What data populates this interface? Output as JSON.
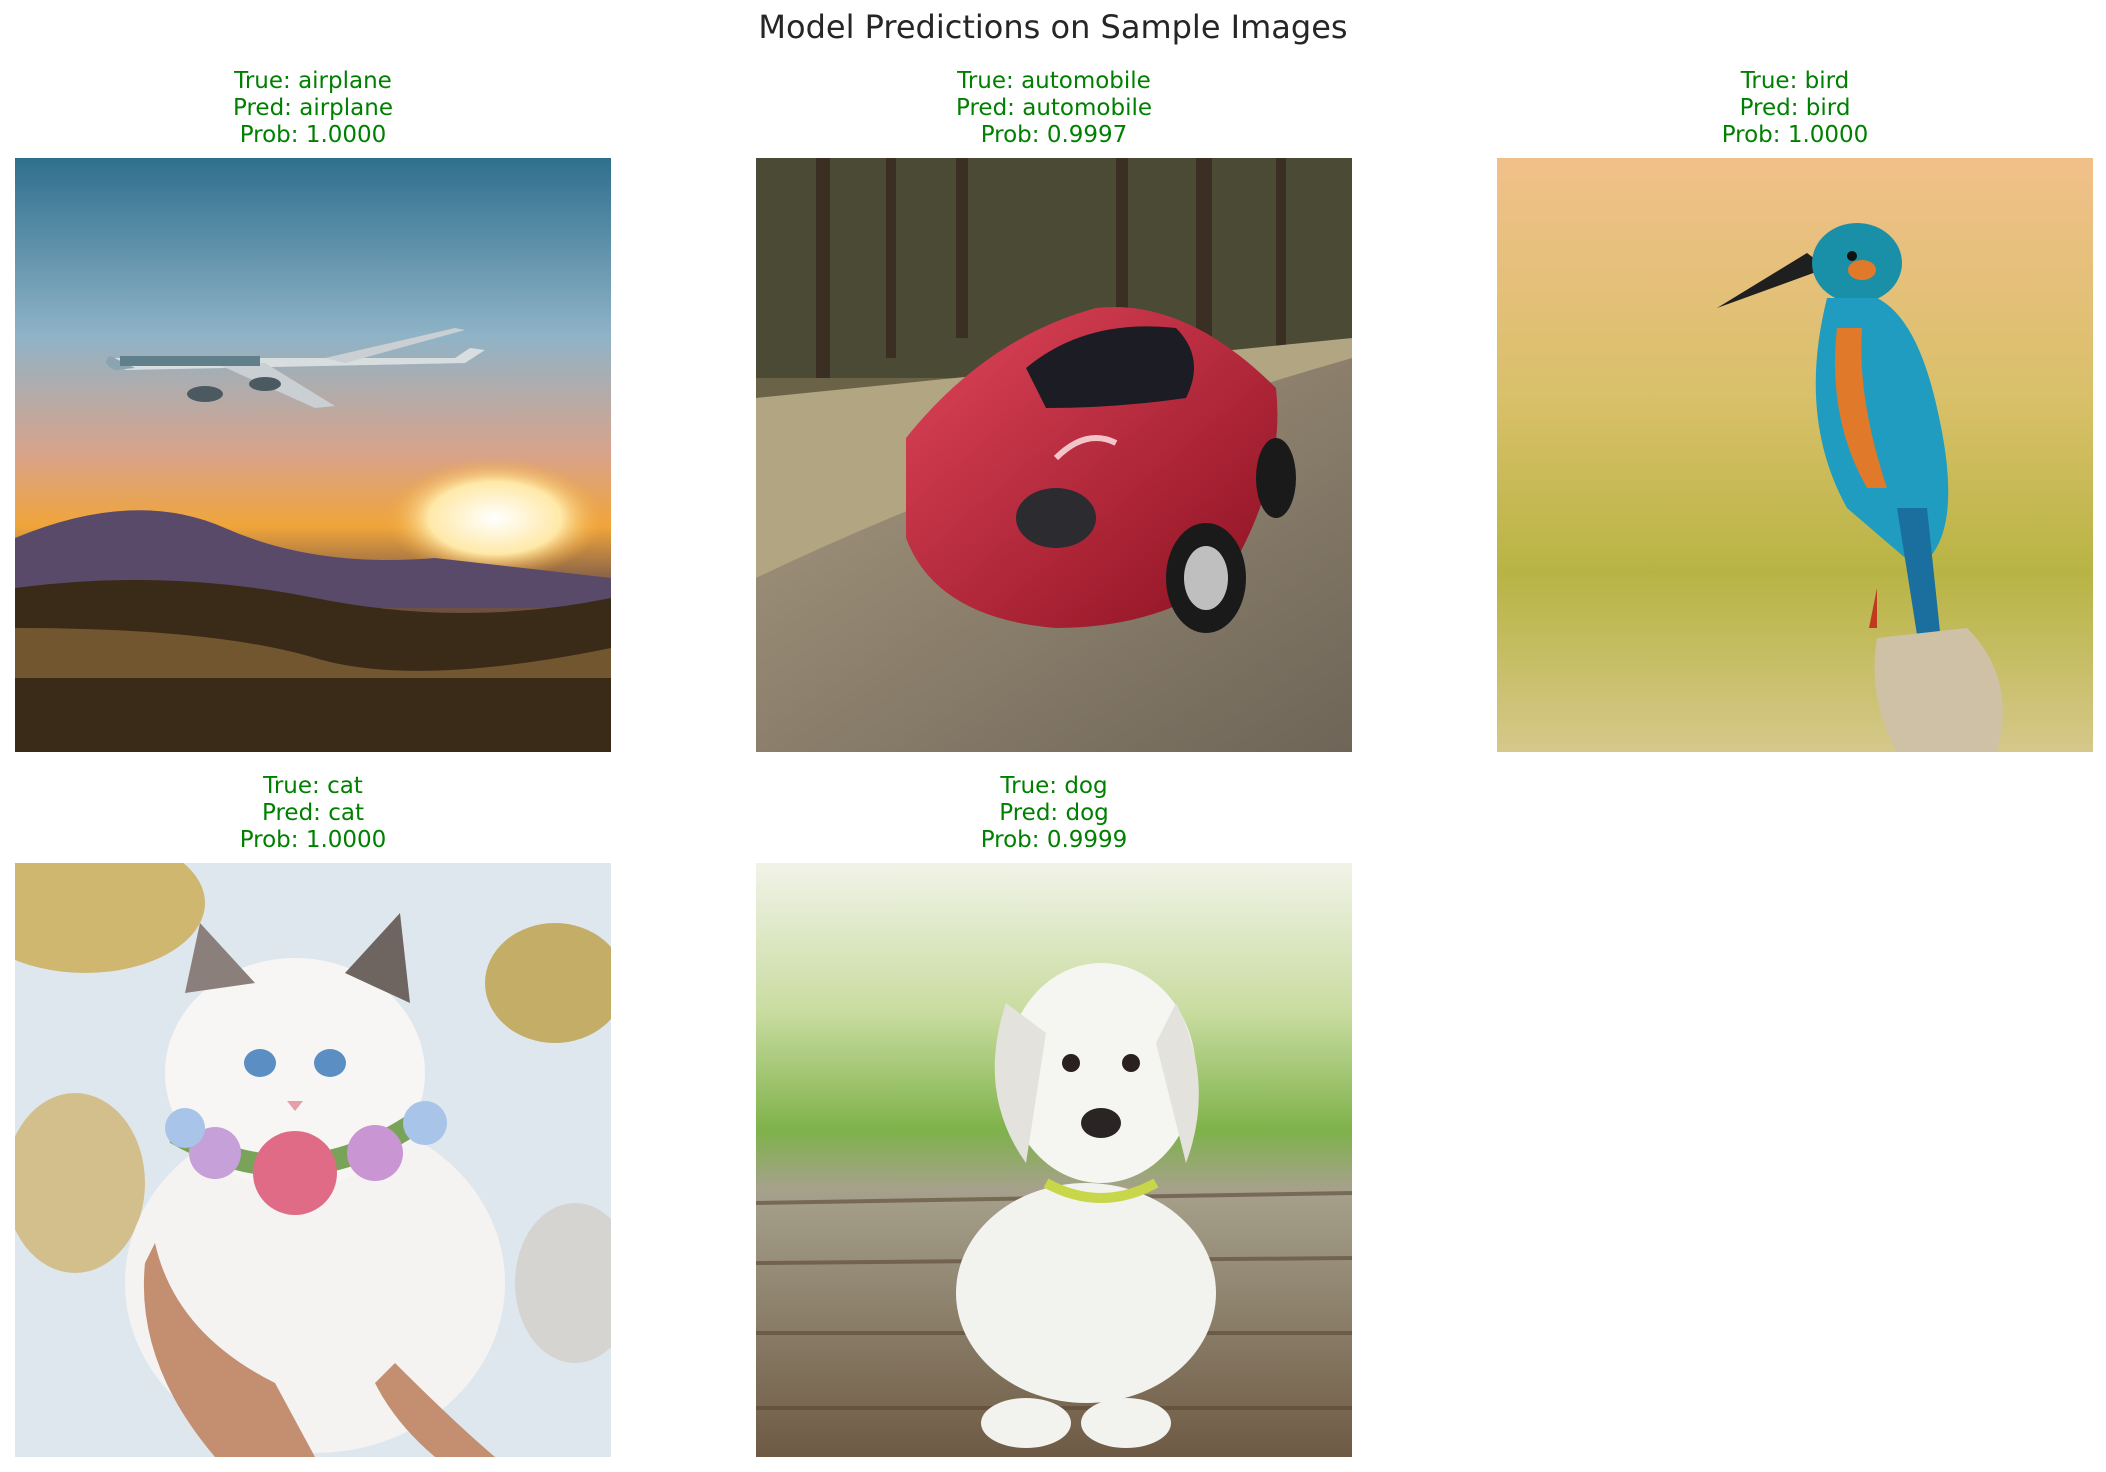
{
  "figure_title": "Model Predictions on Sample Images",
  "panels": [
    {
      "true_label": "True: airplane",
      "pred_label": "Pred: airplane",
      "prob_label": "Prob: 1.0000",
      "image": "airplane-photo"
    },
    {
      "true_label": "True: automobile",
      "pred_label": "Pred: automobile",
      "prob_label": "Prob: 0.9997",
      "image": "red-sports-car-photo"
    },
    {
      "true_label": "True: bird",
      "pred_label": "Pred: bird",
      "prob_label": "Prob: 1.0000",
      "image": "kingfisher-photo"
    },
    {
      "true_label": "True: cat",
      "pred_label": "Pred: cat",
      "prob_label": "Prob: 1.0000",
      "image": "white-kitten-photo"
    },
    {
      "true_label": "True: dog",
      "pred_label": "Pred: dog",
      "prob_label": "Prob: 0.9999",
      "image": "white-puppy-photo"
    }
  ],
  "colors": {
    "caption": "#008000",
    "title": "#262626"
  }
}
